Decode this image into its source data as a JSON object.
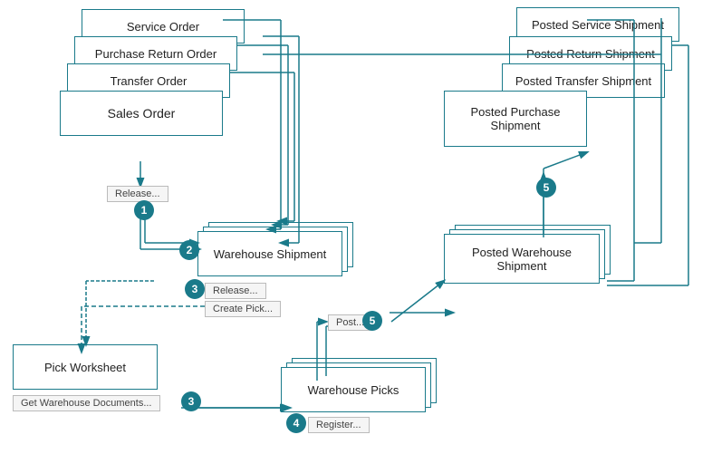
{
  "boxes": {
    "service_order": {
      "label": "Service Order"
    },
    "purchase_return": {
      "label": "Purchase Return Order"
    },
    "transfer_order": {
      "label": "Transfer Order"
    },
    "sales_order": {
      "label": "Sales Order"
    },
    "warehouse_shipment": {
      "label": "Warehouse Shipment"
    },
    "pick_worksheet": {
      "label": "Pick Worksheet"
    },
    "warehouse_picks": {
      "label": "Warehouse Picks"
    },
    "posted_service": {
      "label": "Posted Service Shipment"
    },
    "posted_return": {
      "label": "Posted Return Shipment"
    },
    "posted_transfer": {
      "label": "Posted Transfer Shipment"
    },
    "posted_purchase": {
      "label": "Posted Purchase Shipment"
    },
    "posted_warehouse": {
      "label": "Posted Warehouse Shipment"
    }
  },
  "buttons": {
    "release1": {
      "label": "Release..."
    },
    "release3": {
      "label": "Release..."
    },
    "create_pick": {
      "label": "Create Pick..."
    },
    "post5": {
      "label": "Post..."
    },
    "get_warehouse": {
      "label": "Get Warehouse Documents..."
    },
    "register": {
      "label": "Register..."
    }
  },
  "badges": {
    "b1": "1",
    "b2": "2",
    "b3a": "3",
    "b3b": "3",
    "b4": "4",
    "b5a": "5",
    "b5b": "5"
  }
}
